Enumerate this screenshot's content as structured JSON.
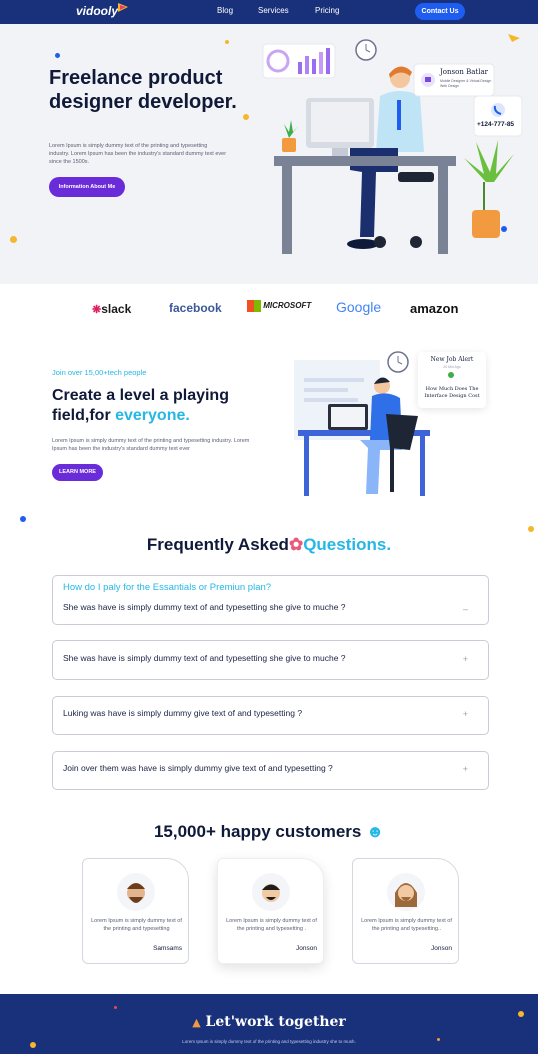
{
  "nav": {
    "logo": "vidooly",
    "links": [
      "Blog",
      "Services",
      "Pricing"
    ],
    "cta": "Contact Us"
  },
  "hero": {
    "title": "Freelance product designer developer.",
    "text": "Lorem Ipsum is simply dummy text of the printing and typesetting industry. Lorem Ipsum has been the industry's standard dummy text ever since the 1500s.",
    "button": "Information About Me",
    "profile_name": "Jonson Batlar",
    "profile_role": "Mobile Designer & Virtual Design Web Design",
    "phone": "+124-777-85"
  },
  "brands": [
    "slack",
    "facebook",
    "MICROSOFT",
    "Google",
    "amazon"
  ],
  "section2": {
    "kicker": "Join over 15,00+tech people",
    "title_part1": "Create a level a playing field,for ",
    "title_accent": "everyone.",
    "text": "Lorem Ipsum is simply dummy text of the printing and typesetting industry. Lorem Ipsum has been the industry's standard dummy text ever",
    "button": "LEARN MORE",
    "alert_title": "New Job Alert",
    "alert_time": "20 Min Ago",
    "alert_text": "How Much Does The Interface Design Cost"
  },
  "faq": {
    "title_part1": "Frequently Asked",
    "title_accent": "Questions.",
    "items": [
      {
        "head": "How do I paly for the Essantials or Premiun plan?",
        "q": "She was have  is simply dummy text of and typesetting she give to muche ?",
        "toggle": "–"
      },
      {
        "q": "She was have  is simply dummy text of and typesetting she give to muche ?",
        "toggle": "+"
      },
      {
        "q": "Luking was have  is simply dummy  give text of and typesetting ?",
        "toggle": "+"
      },
      {
        "q": "Join over them  was have  is simply dummy  give text of and typesetting ?",
        "toggle": "+"
      }
    ]
  },
  "customers": {
    "title": "15,000+ happy customers",
    "cards": [
      {
        "text": "Lorem Ipsum is simply dummy text of the printing and typesetting",
        "name": "Samsams"
      },
      {
        "text": "Lorem Ipsum is simply dummy text of the printing and typesetting .",
        "name": "Jonson"
      },
      {
        "text": "Lorem Ipsum is simply dummy text of the printing and typesetting..",
        "name": "Jonson"
      }
    ]
  },
  "footer": {
    "title": "Let'work together",
    "text": "Lorem Ipsum is simply dummy text of the printing and typesetting industry she to mush."
  },
  "colors": {
    "navy": "#19307a",
    "purple": "#6a2bd9",
    "cyan": "#25b7e6",
    "blue": "#1f5cf0"
  }
}
